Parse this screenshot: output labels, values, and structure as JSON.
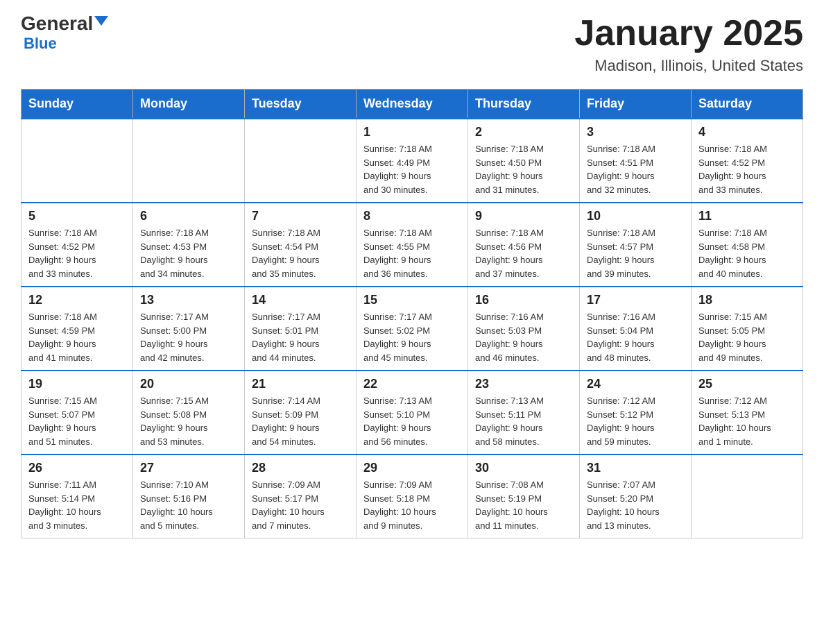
{
  "header": {
    "logo": {
      "general": "General",
      "blue": "Blue"
    },
    "title": "January 2025",
    "subtitle": "Madison, Illinois, United States"
  },
  "days_of_week": [
    "Sunday",
    "Monday",
    "Tuesday",
    "Wednesday",
    "Thursday",
    "Friday",
    "Saturday"
  ],
  "weeks": [
    [
      {
        "day": "",
        "info": ""
      },
      {
        "day": "",
        "info": ""
      },
      {
        "day": "",
        "info": ""
      },
      {
        "day": "1",
        "info": "Sunrise: 7:18 AM\nSunset: 4:49 PM\nDaylight: 9 hours\nand 30 minutes."
      },
      {
        "day": "2",
        "info": "Sunrise: 7:18 AM\nSunset: 4:50 PM\nDaylight: 9 hours\nand 31 minutes."
      },
      {
        "day": "3",
        "info": "Sunrise: 7:18 AM\nSunset: 4:51 PM\nDaylight: 9 hours\nand 32 minutes."
      },
      {
        "day": "4",
        "info": "Sunrise: 7:18 AM\nSunset: 4:52 PM\nDaylight: 9 hours\nand 33 minutes."
      }
    ],
    [
      {
        "day": "5",
        "info": "Sunrise: 7:18 AM\nSunset: 4:52 PM\nDaylight: 9 hours\nand 33 minutes."
      },
      {
        "day": "6",
        "info": "Sunrise: 7:18 AM\nSunset: 4:53 PM\nDaylight: 9 hours\nand 34 minutes."
      },
      {
        "day": "7",
        "info": "Sunrise: 7:18 AM\nSunset: 4:54 PM\nDaylight: 9 hours\nand 35 minutes."
      },
      {
        "day": "8",
        "info": "Sunrise: 7:18 AM\nSunset: 4:55 PM\nDaylight: 9 hours\nand 36 minutes."
      },
      {
        "day": "9",
        "info": "Sunrise: 7:18 AM\nSunset: 4:56 PM\nDaylight: 9 hours\nand 37 minutes."
      },
      {
        "day": "10",
        "info": "Sunrise: 7:18 AM\nSunset: 4:57 PM\nDaylight: 9 hours\nand 39 minutes."
      },
      {
        "day": "11",
        "info": "Sunrise: 7:18 AM\nSunset: 4:58 PM\nDaylight: 9 hours\nand 40 minutes."
      }
    ],
    [
      {
        "day": "12",
        "info": "Sunrise: 7:18 AM\nSunset: 4:59 PM\nDaylight: 9 hours\nand 41 minutes."
      },
      {
        "day": "13",
        "info": "Sunrise: 7:17 AM\nSunset: 5:00 PM\nDaylight: 9 hours\nand 42 minutes."
      },
      {
        "day": "14",
        "info": "Sunrise: 7:17 AM\nSunset: 5:01 PM\nDaylight: 9 hours\nand 44 minutes."
      },
      {
        "day": "15",
        "info": "Sunrise: 7:17 AM\nSunset: 5:02 PM\nDaylight: 9 hours\nand 45 minutes."
      },
      {
        "day": "16",
        "info": "Sunrise: 7:16 AM\nSunset: 5:03 PM\nDaylight: 9 hours\nand 46 minutes."
      },
      {
        "day": "17",
        "info": "Sunrise: 7:16 AM\nSunset: 5:04 PM\nDaylight: 9 hours\nand 48 minutes."
      },
      {
        "day": "18",
        "info": "Sunrise: 7:15 AM\nSunset: 5:05 PM\nDaylight: 9 hours\nand 49 minutes."
      }
    ],
    [
      {
        "day": "19",
        "info": "Sunrise: 7:15 AM\nSunset: 5:07 PM\nDaylight: 9 hours\nand 51 minutes."
      },
      {
        "day": "20",
        "info": "Sunrise: 7:15 AM\nSunset: 5:08 PM\nDaylight: 9 hours\nand 53 minutes."
      },
      {
        "day": "21",
        "info": "Sunrise: 7:14 AM\nSunset: 5:09 PM\nDaylight: 9 hours\nand 54 minutes."
      },
      {
        "day": "22",
        "info": "Sunrise: 7:13 AM\nSunset: 5:10 PM\nDaylight: 9 hours\nand 56 minutes."
      },
      {
        "day": "23",
        "info": "Sunrise: 7:13 AM\nSunset: 5:11 PM\nDaylight: 9 hours\nand 58 minutes."
      },
      {
        "day": "24",
        "info": "Sunrise: 7:12 AM\nSunset: 5:12 PM\nDaylight: 9 hours\nand 59 minutes."
      },
      {
        "day": "25",
        "info": "Sunrise: 7:12 AM\nSunset: 5:13 PM\nDaylight: 10 hours\nand 1 minute."
      }
    ],
    [
      {
        "day": "26",
        "info": "Sunrise: 7:11 AM\nSunset: 5:14 PM\nDaylight: 10 hours\nand 3 minutes."
      },
      {
        "day": "27",
        "info": "Sunrise: 7:10 AM\nSunset: 5:16 PM\nDaylight: 10 hours\nand 5 minutes."
      },
      {
        "day": "28",
        "info": "Sunrise: 7:09 AM\nSunset: 5:17 PM\nDaylight: 10 hours\nand 7 minutes."
      },
      {
        "day": "29",
        "info": "Sunrise: 7:09 AM\nSunset: 5:18 PM\nDaylight: 10 hours\nand 9 minutes."
      },
      {
        "day": "30",
        "info": "Sunrise: 7:08 AM\nSunset: 5:19 PM\nDaylight: 10 hours\nand 11 minutes."
      },
      {
        "day": "31",
        "info": "Sunrise: 7:07 AM\nSunset: 5:20 PM\nDaylight: 10 hours\nand 13 minutes."
      },
      {
        "day": "",
        "info": ""
      }
    ]
  ]
}
